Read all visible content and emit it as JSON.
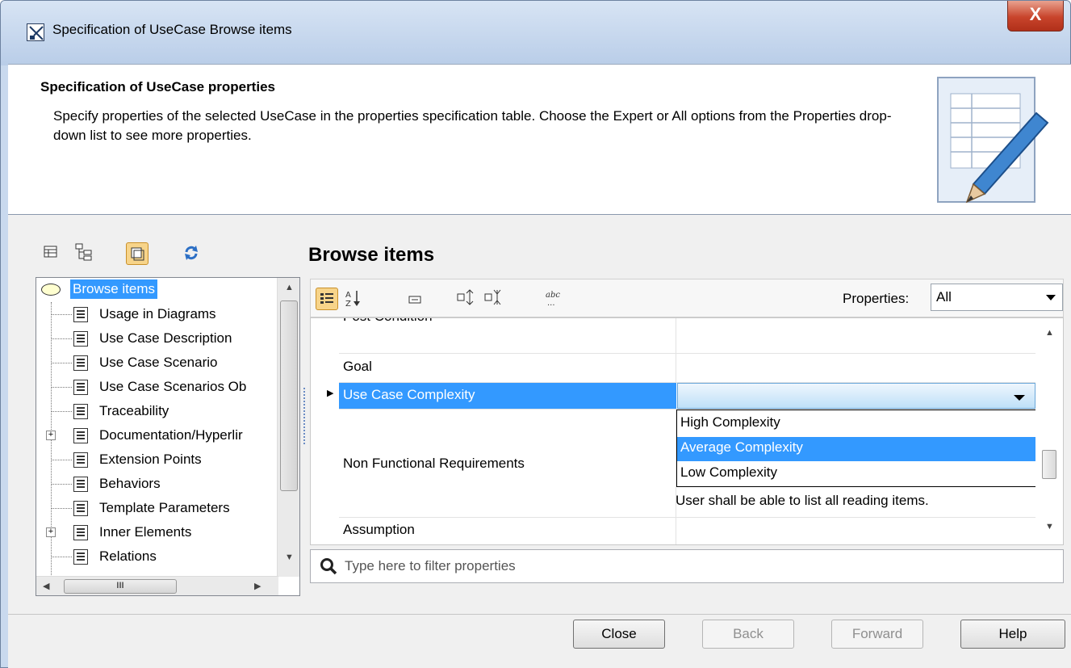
{
  "window": {
    "title": "Specification of UseCase Browse items",
    "close_glyph": "X"
  },
  "header": {
    "title": "Specification of UseCase properties",
    "description": "Specify properties of the selected UseCase in the properties specification table. Choose the Expert or All options from the Properties drop-down list to see more properties.",
    "icon": "document-pencil-icon"
  },
  "left_toolbar": {
    "icons": [
      "table-view-icon",
      "tree-view-icon",
      "window-toggle-icon",
      "refresh-icon"
    ]
  },
  "tree": {
    "root": {
      "label": "Browse items",
      "selected": true
    },
    "items": [
      {
        "label": "Usage in Diagrams",
        "expandable": false
      },
      {
        "label": "Use Case Description",
        "expandable": false
      },
      {
        "label": "Use Case Scenario",
        "expandable": false
      },
      {
        "label": "Use Case Scenarios Ob",
        "expandable": false
      },
      {
        "label": "Traceability",
        "expandable": false
      },
      {
        "label": "Documentation/Hyperlir",
        "expandable": true
      },
      {
        "label": "Extension Points",
        "expandable": false
      },
      {
        "label": "Behaviors",
        "expandable": false
      },
      {
        "label": "Template Parameters",
        "expandable": false
      },
      {
        "label": "Inner Elements",
        "expandable": true
      },
      {
        "label": "Relations",
        "expandable": false
      }
    ],
    "hscroll_thumb": "III"
  },
  "panel": {
    "title": "Browse items",
    "properties_label": "Properties:",
    "properties_value": "All",
    "toolbar_icons": [
      "categorized-icon",
      "sort-alpha-icon",
      "collapse-icon",
      "expand-all-icon",
      "collapse-all-icon",
      "abc-icon"
    ]
  },
  "grid": {
    "rows": [
      {
        "name": "Post Condition",
        "value": ""
      },
      {
        "name": "Goal",
        "value": ""
      },
      {
        "name": "Use Case Complexity",
        "value": "",
        "selected": true
      },
      {
        "name": "Non Functional Requirements",
        "value": "User shall be able to list all reading items."
      },
      {
        "name": "Assumption",
        "value": ""
      }
    ],
    "dropdown_options": [
      "High Complexity",
      "Average Complexity",
      "Low Complexity"
    ],
    "dropdown_selected_index": 1
  },
  "filter": {
    "placeholder": "Type here to filter properties"
  },
  "buttons": {
    "close": "Close",
    "back": "Back",
    "forward": "Forward",
    "help": "Help"
  }
}
